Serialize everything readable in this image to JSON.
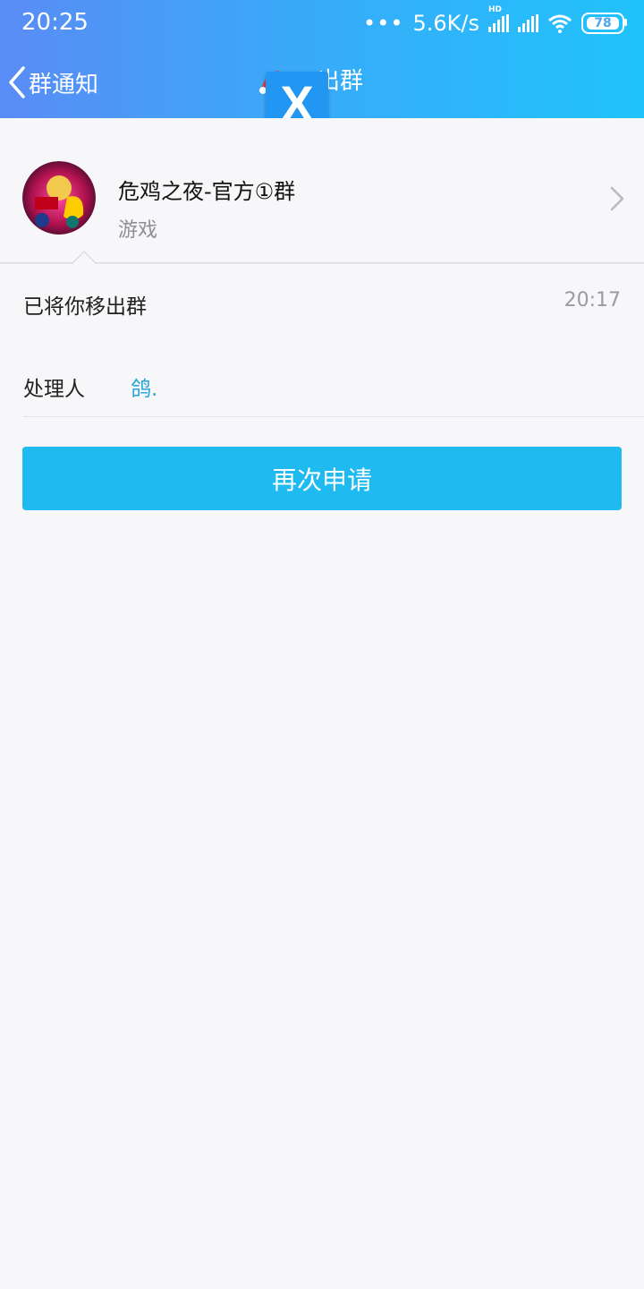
{
  "status_bar": {
    "time": "20:25",
    "dots": "•••",
    "network_speed": "5.6K/s",
    "hd_label": "HD",
    "battery": "78",
    "icons": [
      "signal-hd-icon",
      "signal-icon",
      "wifi-icon",
      "battery-icon"
    ]
  },
  "nav": {
    "back_label": "群通知",
    "title": "出群"
  },
  "group": {
    "name": "危鸡之夜-官方①群",
    "category": "游戏"
  },
  "notice": {
    "message": "已将你移出群",
    "time": "20:17",
    "handler_label": "处理人",
    "handler_name": "鸽."
  },
  "actions": {
    "reapply_label": "再次申请"
  },
  "overlay": {
    "badge_label": "X"
  },
  "colors": {
    "header_start": "#5a8cf6",
    "header_end": "#20c3fb",
    "button": "#1fbaf0",
    "link": "#2aa5d8",
    "background": "#f7f7f9"
  }
}
